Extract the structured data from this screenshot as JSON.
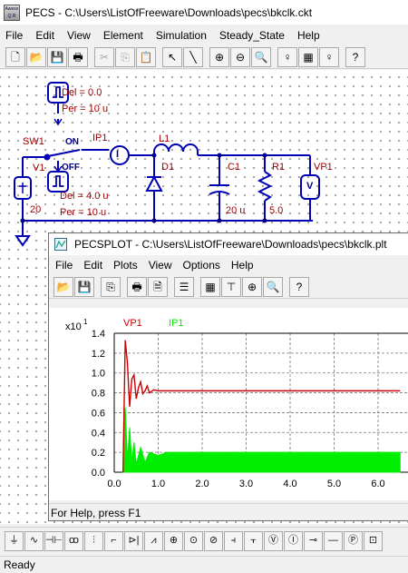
{
  "window": {
    "title": "PECS - C:\\Users\\ListOfFreeware\\Downloads\\pecs\\bkclk.ckt",
    "icon_label": "Aweso Q.R"
  },
  "menu": [
    "File",
    "Edit",
    "View",
    "Element",
    "Simulation",
    "Steady_State",
    "Help"
  ],
  "toolbar": {
    "items": [
      {
        "name": "new-file-icon",
        "glyph": "🗋",
        "enabled": true
      },
      {
        "name": "open-folder-icon",
        "glyph": "📂",
        "enabled": true
      },
      {
        "name": "save-icon",
        "glyph": "💾",
        "enabled": true
      },
      {
        "name": "print-icon",
        "glyph": "🖶",
        "enabled": true
      },
      {
        "name": "cut-icon",
        "glyph": "✂",
        "enabled": false
      },
      {
        "name": "copy-icon",
        "glyph": "⎘",
        "enabled": false
      },
      {
        "name": "paste-icon",
        "glyph": "📋",
        "enabled": false
      },
      {
        "name": "pointer-tool-icon",
        "glyph": "↖",
        "enabled": true
      },
      {
        "name": "wire-tool-icon",
        "glyph": "╲",
        "enabled": true
      },
      {
        "name": "zoom-in-icon",
        "glyph": "⊕",
        "enabled": true
      },
      {
        "name": "zoom-out-icon",
        "glyph": "⊖",
        "enabled": true
      },
      {
        "name": "zoom-fit-icon",
        "glyph": "🔍",
        "enabled": true
      },
      {
        "name": "run-simulation-icon",
        "glyph": "♀",
        "enabled": true
      },
      {
        "name": "plot-window-icon",
        "glyph": "▦",
        "enabled": true
      },
      {
        "name": "steady-state-icon",
        "glyph": "♀",
        "enabled": true
      },
      {
        "name": "help-icon",
        "glyph": "?",
        "enabled": true
      }
    ]
  },
  "schematic": {
    "sw1_label": "SW1",
    "v1_label": "V1",
    "v1_value": "20",
    "clk1_del": "Del = 0.0",
    "clk1_per": "Per = 10 u",
    "on_label": "ON",
    "off_label": "OFF",
    "clk2_del": "Del = 4.0 u",
    "clk2_per": "Per = 10 u",
    "ip1_label": "IP1",
    "ammeter_symbol": "I",
    "l1_label": "L1",
    "d1_label": "D1",
    "c1_label": "C1",
    "c1_value": "20 u",
    "r1_label": "R1",
    "r1_value": "5.0",
    "vp1_label": "VP1",
    "voltmeter_symbol": "V"
  },
  "plot_window": {
    "title": "PECSPLOT - C:\\Users\\ListOfFreeware\\Downloads\\pecs\\bkclk.plt",
    "menu": [
      "File",
      "Edit",
      "Plots",
      "View",
      "Options",
      "Help"
    ],
    "toolbar": [
      {
        "name": "open-folder-icon",
        "glyph": "📂"
      },
      {
        "name": "save-icon",
        "glyph": "💾"
      },
      {
        "name": "copy-icon",
        "glyph": "⎘"
      },
      {
        "name": "print-icon",
        "glyph": "🖶"
      },
      {
        "name": "print-preview-icon",
        "glyph": "🗎"
      },
      {
        "name": "table-icon",
        "glyph": "☰"
      },
      {
        "name": "grid-icon",
        "glyph": "▦"
      },
      {
        "name": "marker-icon",
        "glyph": "⊤"
      },
      {
        "name": "zoom-in-icon",
        "glyph": "⊕"
      },
      {
        "name": "zoom-fit-icon",
        "glyph": "🔍"
      },
      {
        "name": "help-icon",
        "glyph": "?"
      }
    ],
    "status": "For Help, press F1",
    "colors": {
      "vp1": "#cc0000",
      "ip1": "#00ee00"
    }
  },
  "chart_data": {
    "type": "line",
    "multiplier": "x10",
    "multiplier_exp": "1",
    "xlim": [
      0,
      6.5
    ],
    "ylim": [
      0,
      1.4
    ],
    "xticks": [
      "0.0",
      "1.0",
      "2.0",
      "3.0",
      "4.0",
      "5.0",
      "6.0"
    ],
    "yticks": [
      "0.0",
      "0.2",
      "0.4",
      "0.6",
      "0.8",
      "1.0",
      "1.2",
      "1.4"
    ],
    "grid": true,
    "legend": [
      "VP1",
      "IP1"
    ],
    "series": [
      {
        "name": "VP1",
        "color": "#cc0000",
        "x": [
          0.2,
          0.25,
          0.3,
          0.35,
          0.4,
          0.45,
          0.5,
          0.55,
          0.6,
          0.65,
          0.7,
          0.75,
          0.8,
          0.9,
          1.0,
          1.1,
          1.2,
          1.4,
          6.5
        ],
        "values": [
          0.0,
          1.33,
          1.1,
          0.66,
          0.94,
          0.98,
          0.74,
          0.85,
          0.91,
          0.79,
          0.82,
          0.87,
          0.8,
          0.83,
          0.82,
          0.82,
          0.82,
          0.82,
          0.82
        ]
      },
      {
        "name": "IP1",
        "color": "#00ee00",
        "x": [
          0.2,
          0.25,
          0.3,
          0.35,
          0.4,
          0.45,
          0.5,
          0.6,
          0.7,
          0.8,
          1.0,
          1.2,
          1.5,
          6.5
        ],
        "values": [
          0.0,
          0.65,
          0.12,
          0.45,
          0.1,
          0.3,
          0.08,
          0.25,
          0.1,
          0.2,
          0.17,
          0.2,
          0.2,
          0.2
        ],
        "band_low": 0.0
      }
    ]
  },
  "bottom_toolbar": [
    {
      "name": "ground-icon",
      "glyph": "⏚"
    },
    {
      "name": "sine-source-icon",
      "glyph": "∿"
    },
    {
      "name": "capacitor-icon",
      "glyph": "⊣⊢"
    },
    {
      "name": "inductor-icon",
      "glyph": "ꝏ"
    },
    {
      "name": "transformer-icon",
      "glyph": "⫶"
    },
    {
      "name": "switch-icon",
      "glyph": "⌐"
    },
    {
      "name": "diode-icon",
      "glyph": "⊳|"
    },
    {
      "name": "resistor-icon",
      "glyph": "⩘"
    },
    {
      "name": "dc-source-icon",
      "glyph": "⊕"
    },
    {
      "name": "current-source-icon",
      "glyph": "⊙"
    },
    {
      "name": "ac-source-icon",
      "glyph": "⊘"
    },
    {
      "name": "battery-icon",
      "glyph": "⫞"
    },
    {
      "name": "controlled-source-icon",
      "glyph": "⫟"
    },
    {
      "name": "voltage-probe-icon",
      "glyph": "Ⓥ"
    },
    {
      "name": "current-probe-icon",
      "glyph": "Ⓘ"
    },
    {
      "name": "node-icon",
      "glyph": "⊸"
    },
    {
      "name": "wire-icon",
      "glyph": "—"
    },
    {
      "name": "label-icon",
      "glyph": "Ⓟ"
    },
    {
      "name": "subcircuit-icon",
      "glyph": "⊡"
    }
  ],
  "status": "Ready"
}
